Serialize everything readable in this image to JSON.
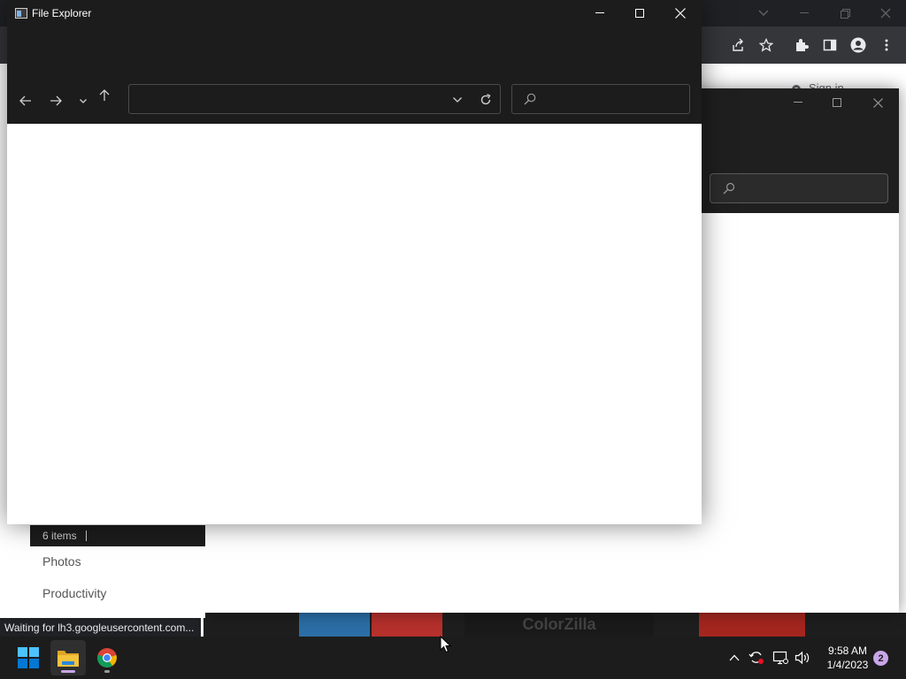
{
  "file_explorer": {
    "title": "File Explorer",
    "address_value": "",
    "search_placeholder": ""
  },
  "explorer_status": {
    "item_count": "6 items"
  },
  "nav_pane": {
    "items": [
      "Photos",
      "Productivity"
    ]
  },
  "chrome": {
    "signin_label": "Sign in",
    "loading_status": "Waiting for lh3.googleusercontent.com...",
    "thumbnail_label": "ColorZilla"
  },
  "taskbar": {
    "apps": [
      {
        "name": "start-button",
        "icon": "windows-logo-icon"
      },
      {
        "name": "file-explorer",
        "icon": "folder-icon",
        "active": true
      },
      {
        "name": "google-chrome",
        "icon": "chrome-icon",
        "active": false
      }
    ],
    "clock_time": "9:58 AM",
    "clock_date": "1/4/2023",
    "notification_count": "2"
  },
  "colors": {
    "window_dark": "#1c1c1c",
    "accent_blue": "#0078d4",
    "folder_yellow": "#f3c33b",
    "indicator_pink": "#c9a6e8"
  }
}
